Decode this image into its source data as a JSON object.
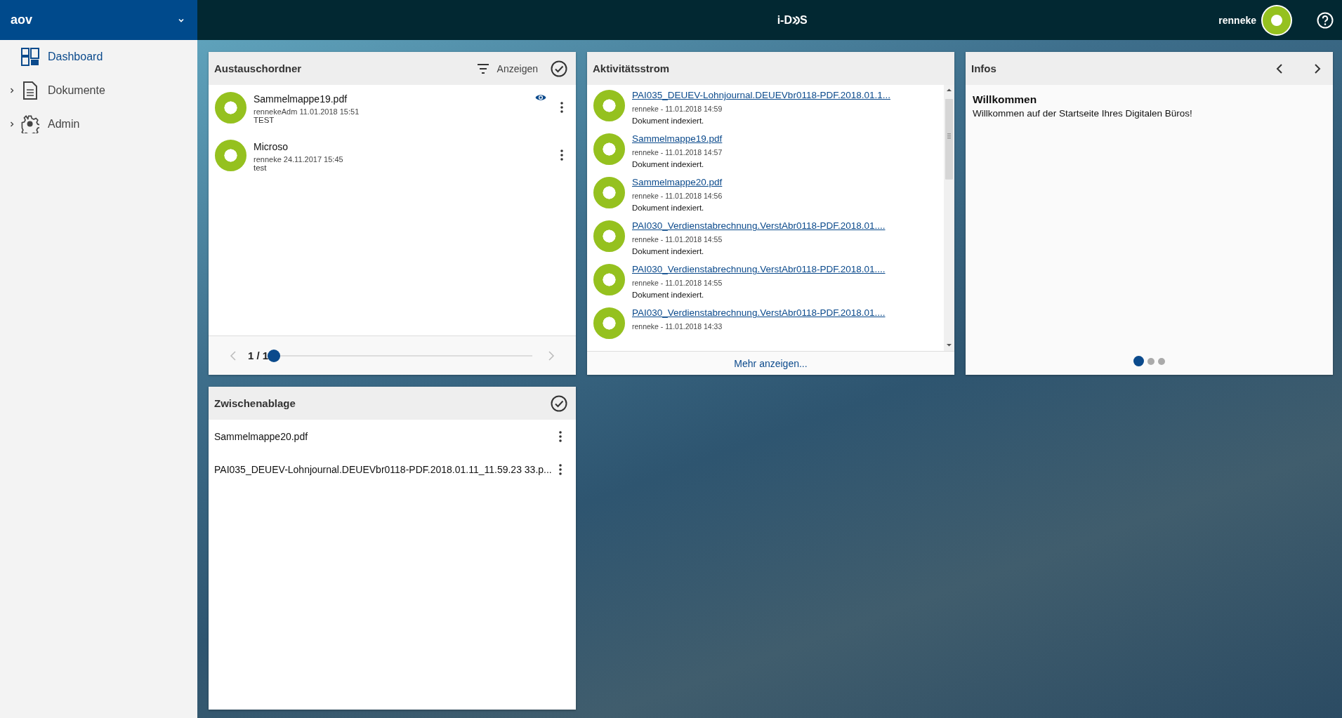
{
  "sidebar": {
    "title": "aov",
    "items": [
      {
        "label": "Dashboard",
        "selected": true,
        "expandable": false
      },
      {
        "label": "Dokumente",
        "selected": false,
        "expandable": true
      },
      {
        "label": "Admin",
        "selected": false,
        "expandable": true
      }
    ]
  },
  "header": {
    "logo_left": "i-D",
    "logo_right": "S",
    "user": "renneke"
  },
  "exchange_folder": {
    "title": "Austauschordner",
    "filter_label": "Anzeigen",
    "items": [
      {
        "name": "Sammelmappe19.pdf",
        "meta": "rennekeAdm 11.01.2018 15:51",
        "note": "TEST",
        "watched": true
      },
      {
        "name": "Microso",
        "meta": "renneke 24.11.2017 15:45",
        "note": "test",
        "watched": false
      }
    ],
    "pager": {
      "text": "1 / 1",
      "level": 0
    }
  },
  "activity": {
    "title": "Aktivitätsstrom",
    "items": [
      {
        "link": "PAI035_DEUEV-Lohnjournal.DEUEVbr0118-PDF.2018.01.1...",
        "meta": "renneke - 11.01.2018 14:59",
        "note": "Dokument indexiert."
      },
      {
        "link": "Sammelmappe19.pdf",
        "meta": "renneke - 11.01.2018 14:57",
        "note": "Dokument indexiert."
      },
      {
        "link": "Sammelmappe20.pdf",
        "meta": "renneke - 11.01.2018 14:56",
        "note": "Dokument indexiert."
      },
      {
        "link": "PAI030_Verdienstabrechnung.VerstAbr0118-PDF.2018.01....",
        "meta": "renneke - 11.01.2018 14:55",
        "note": "Dokument indexiert."
      },
      {
        "link": "PAI030_Verdienstabrechnung.VerstAbr0118-PDF.2018.01....",
        "meta": "renneke - 11.01.2018 14:55",
        "note": "Dokument indexiert."
      },
      {
        "link": "PAI030_Verdienstabrechnung.VerstAbr0118-PDF.2018.01....",
        "meta": "renneke - 11.01.2018 14:33"
      }
    ],
    "more": "Mehr anzeigen..."
  },
  "infos": {
    "title": "Infos",
    "heading": "Willkommen",
    "text": "Willkommen auf der Startseite Ihres Digitalen Büros!",
    "slides": [
      {
        "selected": true
      },
      {
        "selected": false
      },
      {
        "selected": false
      }
    ]
  },
  "clipboard": {
    "title": "Zwischenablage",
    "items": [
      {
        "name": "Sammelmappe20.pdf"
      },
      {
        "name": "PAI035_DEUEV-Lohnjournal.DEUEVbr0118-PDF.2018.01.11_11.59.23 33.p..."
      }
    ]
  }
}
